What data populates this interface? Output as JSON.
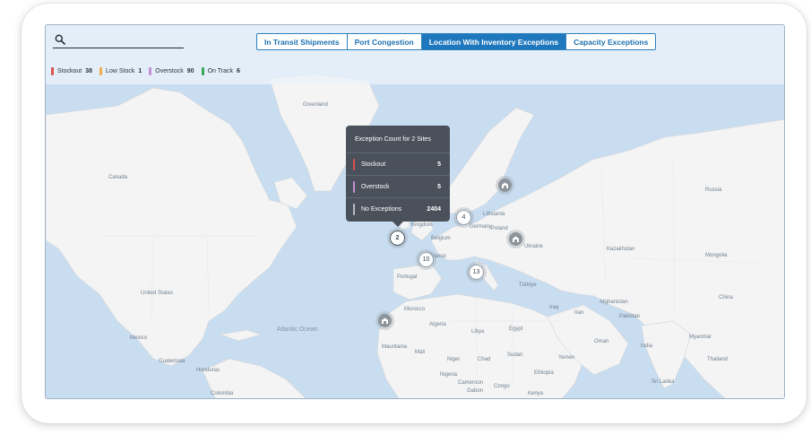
{
  "search": {
    "placeholder": ""
  },
  "tabs": [
    {
      "label": "In Transit Shipments",
      "active": false
    },
    {
      "label": "Port Congestion",
      "active": false
    },
    {
      "label": "Location With Inventory Exceptions",
      "active": true
    },
    {
      "label": "Capacity Exceptions",
      "active": false
    }
  ],
  "legend": [
    {
      "label": "Stockout",
      "count": "38",
      "color": "#d9534f"
    },
    {
      "label": "Low Stock",
      "count": "1",
      "color": "#f0ad4e"
    },
    {
      "label": "Overstock",
      "count": "90",
      "color": "#c58fd6"
    },
    {
      "label": "On Track",
      "count": "6",
      "color": "#3aa757"
    }
  ],
  "map_labels": {
    "greenland": "Greenland",
    "canada": "Canada",
    "united_states": "United States",
    "mexico": "Mexico",
    "guatemala": "Guatemala",
    "honduras": "Honduras",
    "colombia": "Colombia",
    "atlantic_ocean": "Atlantic Ocean",
    "kingdom": "Kingdom",
    "belgium": "Belgium",
    "france": "France",
    "portugal": "Portugal",
    "morocco": "Morocco",
    "algeria": "Algeria",
    "libya": "Libya",
    "egypt": "Egypt",
    "mauritania": "Mauritania",
    "mali": "Mali",
    "niger": "Niger",
    "chad": "Chad",
    "sudan": "Sudan",
    "nigeria": "Nigeria",
    "cameroon": "Cameroon",
    "ethiopia": "Ethiopia",
    "kenya": "Kenya",
    "yemen": "Yemen",
    "oman": "Oman",
    "iran": "Iran",
    "iraq": "Iraq",
    "turkiye": "Türkiye",
    "lithuania": "Lithuania",
    "poland": "Poland",
    "ukraine": "Ukraine",
    "russia": "Russia",
    "kazakhstan": "Kazakhstan",
    "mongolia": "Mongolia",
    "afghanistan": "Afghanistan",
    "pakistan": "Pakistan",
    "india": "India",
    "china": "China",
    "myanmar": "Myanmar",
    "thailand": "Thailand",
    "sri_lanka": "Sri Lanka",
    "gabon": "Gabon",
    "congo": "Congo",
    "germany": "Germany"
  },
  "clusters": [
    {
      "count": "2",
      "selected": true
    },
    {
      "count": "4",
      "selected": false
    },
    {
      "count": "10",
      "selected": false
    },
    {
      "count": "13",
      "selected": false
    }
  ],
  "tooltip": {
    "title": "Exception Count for 2 Sites",
    "rows": [
      {
        "label": "Stockout",
        "value": "5",
        "color": "#d9534f"
      },
      {
        "label": "Overstock",
        "value": "5",
        "color": "#c58fd6"
      },
      {
        "label": "No Exceptions",
        "value": "2404",
        "color": "#b9bec4"
      }
    ]
  },
  "icons": {
    "search": "search-icon",
    "site": "warehouse-icon"
  },
  "colors": {
    "ocean": "#c9ddf0",
    "land": "#f4f4f4",
    "accent": "#1f78bd"
  }
}
